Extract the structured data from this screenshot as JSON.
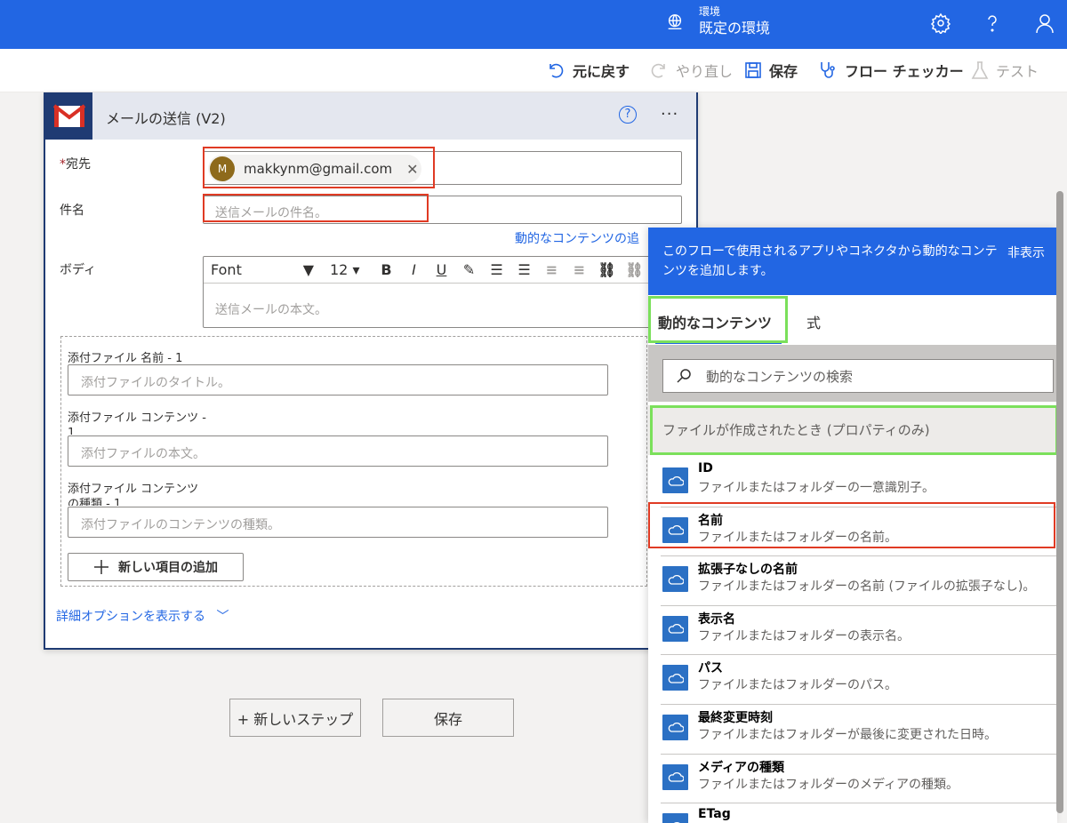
{
  "topbar": {
    "env_label": "環境",
    "env_name": "既定の環境"
  },
  "commands": {
    "undo": "元に戻す",
    "redo": "やり直し",
    "save": "保存",
    "checker": "フロー チェッカー",
    "test": "テスト"
  },
  "card": {
    "title": "メールの送信 (V2)",
    "help": "?",
    "more": "···",
    "to_label": "宛先",
    "required_mark": "*",
    "to_avatar": "M",
    "to_email": "makkynm@gmail.com",
    "subject_label": "件名",
    "subject_placeholder": "送信メールの件名。",
    "dynamic_link": "動的なコンテンツの追",
    "body_label": "ボディ",
    "font_name": "Font",
    "font_size": "12",
    "body_placeholder": "送信メールの本文。",
    "attach_name_label": "添付ファイル 名前 - 1",
    "attach_name_placeholder": "添付ファイルのタイトル。",
    "attach_content_label": "添付ファイル コンテンツ - 1",
    "attach_content_placeholder": "添付ファイルの本文。",
    "attach_type_label": "添付ファイル コンテンツの種類 - 1",
    "attach_type_placeholder": "添付ファイルのコンテンツの種類。",
    "add_item": "新しい項目の追加",
    "advanced": "詳細オプションを表示する"
  },
  "footer": {
    "new_step": "+ 新しいステップ",
    "save": "保存"
  },
  "panel": {
    "description": "このフローで使用されるアプリやコネクタから動的なコンテンツを追加します。",
    "hide": "非表示",
    "tab_dynamic": "動的なコンテンツ",
    "tab_expression": "式",
    "search_placeholder": "動的なコンテンツの検索",
    "group_header": "ファイルが作成されたとき (プロパティのみ)",
    "items": [
      {
        "title": "ID",
        "sub": "ファイルまたはフォルダーの一意識別子。"
      },
      {
        "title": "名前",
        "sub": "ファイルまたはフォルダーの名前。"
      },
      {
        "title": "拡張子なしの名前",
        "sub": "ファイルまたはフォルダーの名前 (ファイルの拡張子なし)。"
      },
      {
        "title": "表示名",
        "sub": "ファイルまたはフォルダーの表示名。"
      },
      {
        "title": "パス",
        "sub": "ファイルまたはフォルダーのパス。"
      },
      {
        "title": "最終変更時刻",
        "sub": "ファイルまたはフォルダーが最後に変更された日時。"
      },
      {
        "title": "メディアの種類",
        "sub": "ファイルまたはフォルダーのメディアの種類。"
      },
      {
        "title": "ETag",
        "sub": ""
      }
    ]
  },
  "colors": {
    "brand": "#2266e3",
    "highlight_red": "#e03b24",
    "highlight_green": "#7be05b"
  }
}
